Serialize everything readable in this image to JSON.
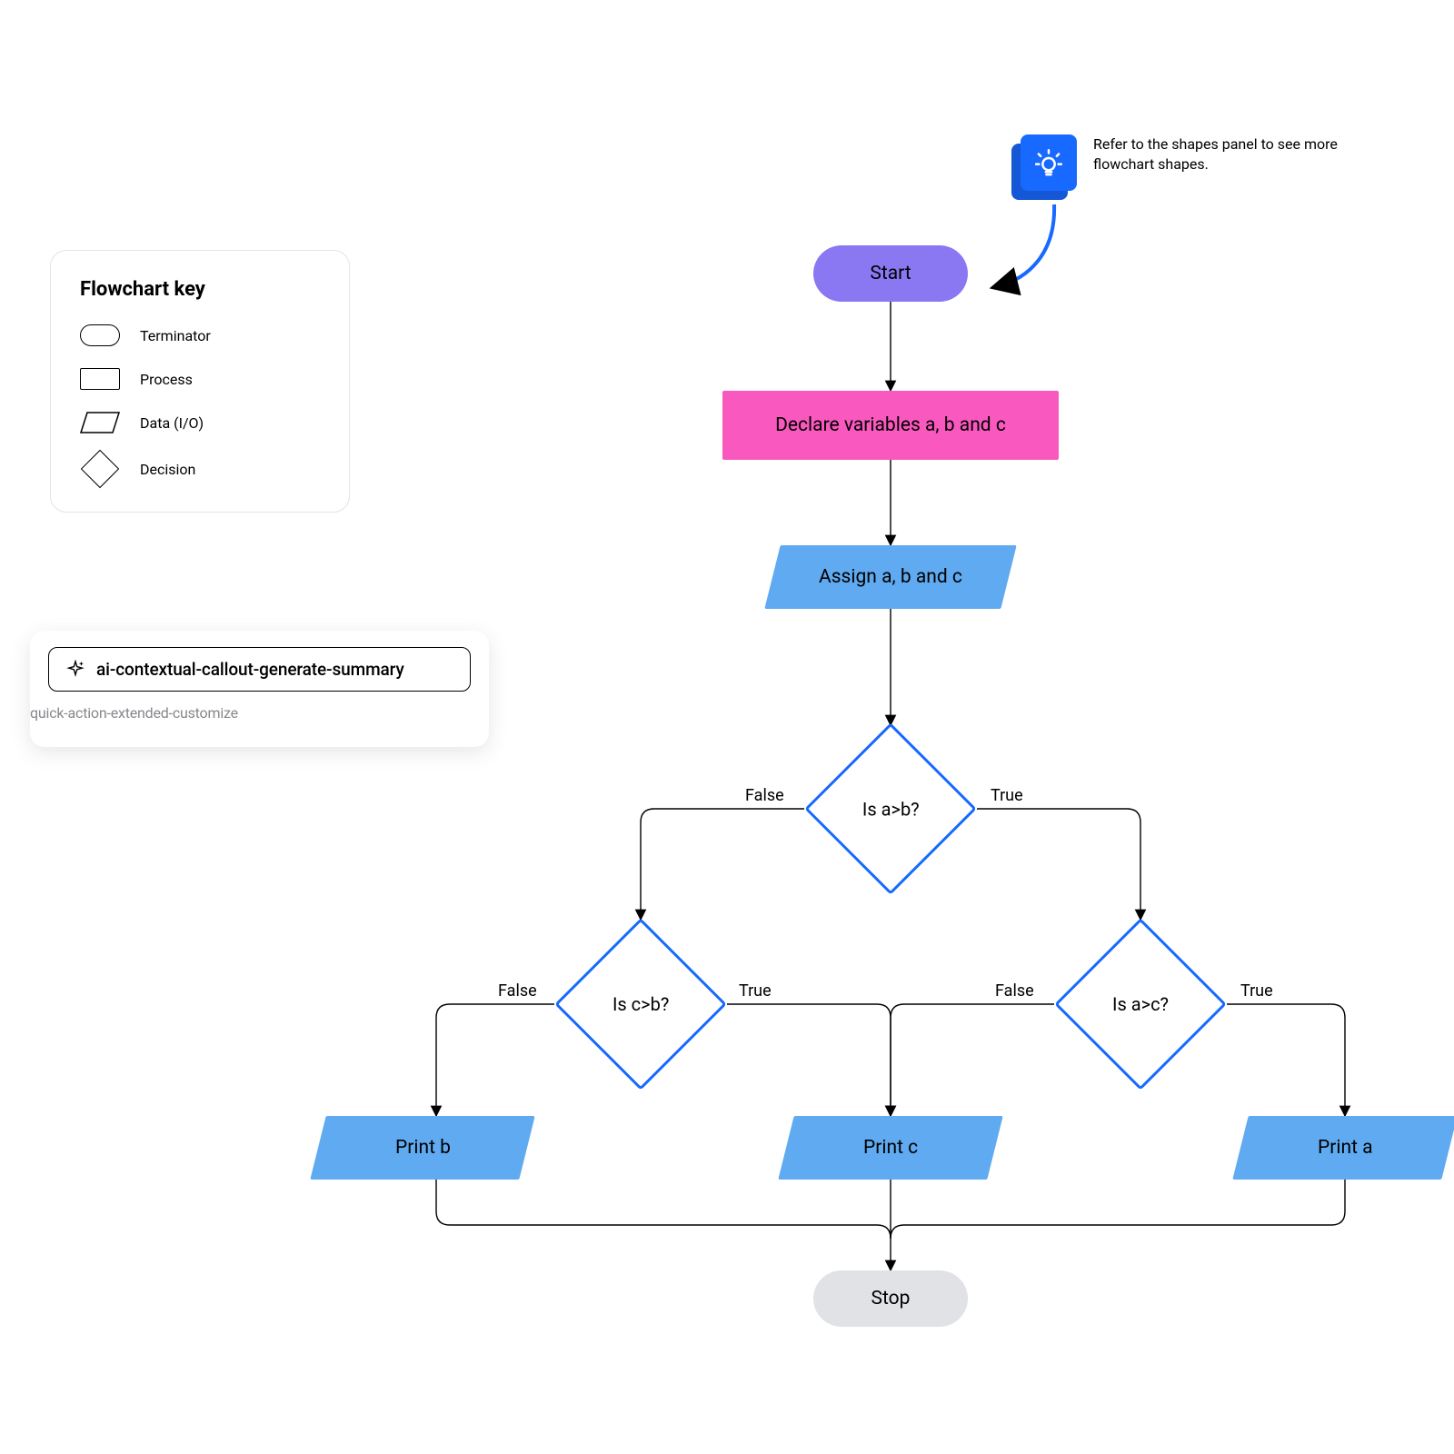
{
  "legend": {
    "title": "Flowchart key",
    "items": [
      {
        "label": "Terminator"
      },
      {
        "label": "Process"
      },
      {
        "label": "Data (I/O)"
      },
      {
        "label": "Decision"
      }
    ]
  },
  "ai_panel": {
    "chip_label": "ai-contextual-callout-generate-summary",
    "subline": "quick-action-extended-customize"
  },
  "tip": {
    "text": "Refer to the shapes panel to see more flowchart shapes."
  },
  "flow": {
    "nodes": {
      "start": {
        "label": "Start"
      },
      "declare": {
        "label": "Declare variables a, b and c"
      },
      "assign": {
        "label": "Assign a, b and c"
      },
      "d1": {
        "label": "Is a>b?"
      },
      "d2": {
        "label": "Is c>b?"
      },
      "d3": {
        "label": "Is a>c?"
      },
      "p_b": {
        "label": "Print b"
      },
      "p_c": {
        "label": "Print c"
      },
      "p_a": {
        "label": "Print a"
      },
      "stop": {
        "label": "Stop"
      }
    },
    "edge_labels": {
      "d1_false": "False",
      "d1_true": "True",
      "d2_false": "False",
      "d2_true": "True",
      "d3_false": "False",
      "d3_true": "True"
    }
  }
}
